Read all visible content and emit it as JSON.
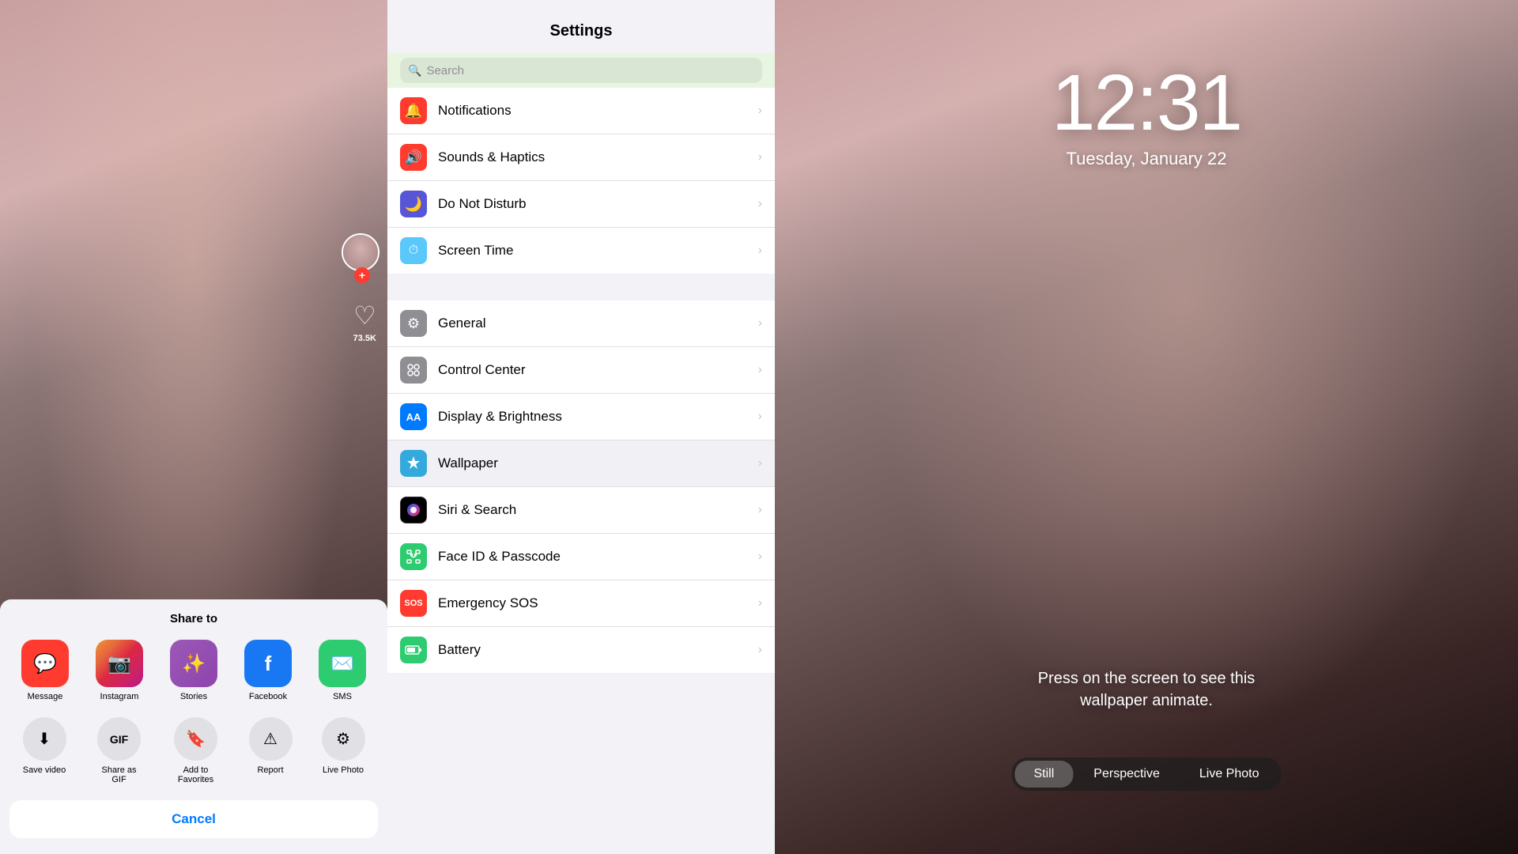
{
  "leftPanel": {
    "shareTitle": "Share to",
    "apps": [
      {
        "id": "message",
        "label": "Message",
        "bg": "#ff3b30",
        "icon": "💬"
      },
      {
        "id": "instagram",
        "label": "Instagram",
        "bg": "#c13584",
        "icon": "📷"
      },
      {
        "id": "stories",
        "label": "Stories",
        "bg": "#9b59b6",
        "icon": "✨"
      },
      {
        "id": "facebook",
        "label": "Facebook",
        "bg": "#1877f2",
        "icon": "f"
      },
      {
        "id": "sms",
        "label": "SMS",
        "bg": "#2ecc71",
        "icon": "✉️"
      }
    ],
    "actions": [
      {
        "id": "save-video",
        "label": "Save video",
        "icon": "⬇"
      },
      {
        "id": "share-gif",
        "label": "Share as GIF",
        "icon": "GIF"
      },
      {
        "id": "add-favorites",
        "label": "Add to Favorites",
        "icon": "🔖"
      },
      {
        "id": "report",
        "label": "Report",
        "icon": "⚠"
      },
      {
        "id": "live-photo",
        "label": "Live Photo",
        "icon": "⚙"
      }
    ],
    "cancelLabel": "Cancel",
    "likeCount": "73.5K"
  },
  "settings": {
    "title": "Settings",
    "searchPlaceholder": "Search",
    "sections": [
      {
        "id": "notifications-section",
        "items": [
          {
            "id": "notifications",
            "label": "Notifications",
            "iconBg": "#ff3b30",
            "iconChar": "🔔"
          },
          {
            "id": "sounds-haptics",
            "label": "Sounds & Haptics",
            "iconBg": "#ff3b30",
            "iconChar": "🔊"
          },
          {
            "id": "do-not-disturb",
            "label": "Do Not Disturb",
            "iconBg": "#5856d6",
            "iconChar": "🌙"
          },
          {
            "id": "screen-time",
            "label": "Screen Time",
            "iconBg": "#5ac8fa",
            "iconChar": "⏱"
          }
        ]
      },
      {
        "id": "general-section",
        "items": [
          {
            "id": "general",
            "label": "General",
            "iconBg": "#8e8e93",
            "iconChar": "⚙"
          },
          {
            "id": "control-center",
            "label": "Control Center",
            "iconBg": "#8e8e93",
            "iconChar": "☰"
          },
          {
            "id": "display-brightness",
            "label": "Display & Brightness",
            "iconBg": "#007aff",
            "iconChar": "AA"
          },
          {
            "id": "wallpaper",
            "label": "Wallpaper",
            "iconBg": "#34aadc",
            "iconChar": "✻",
            "highlighted": true
          },
          {
            "id": "siri-search",
            "label": "Siri & Search",
            "iconBg": "#000000",
            "iconChar": "◉"
          },
          {
            "id": "face-id",
            "label": "Face ID & Passcode",
            "iconBg": "#2ecc71",
            "iconChar": "👤"
          },
          {
            "id": "emergency-sos",
            "label": "Emergency SOS",
            "iconBg": "#ff3b30",
            "iconChar": "SOS"
          },
          {
            "id": "battery",
            "label": "Battery",
            "iconBg": "#2ecc71",
            "iconChar": "▮"
          }
        ]
      }
    ]
  },
  "rightPanel": {
    "time": "12:31",
    "date": "Tuesday, January 22",
    "animateHint": "Press on the screen to see this wallpaper animate.",
    "tabs": [
      {
        "id": "still",
        "label": "Still",
        "active": true
      },
      {
        "id": "perspective",
        "label": "Perspective",
        "active": false
      },
      {
        "id": "live-photo",
        "label": "Live Photo",
        "active": false
      }
    ]
  }
}
